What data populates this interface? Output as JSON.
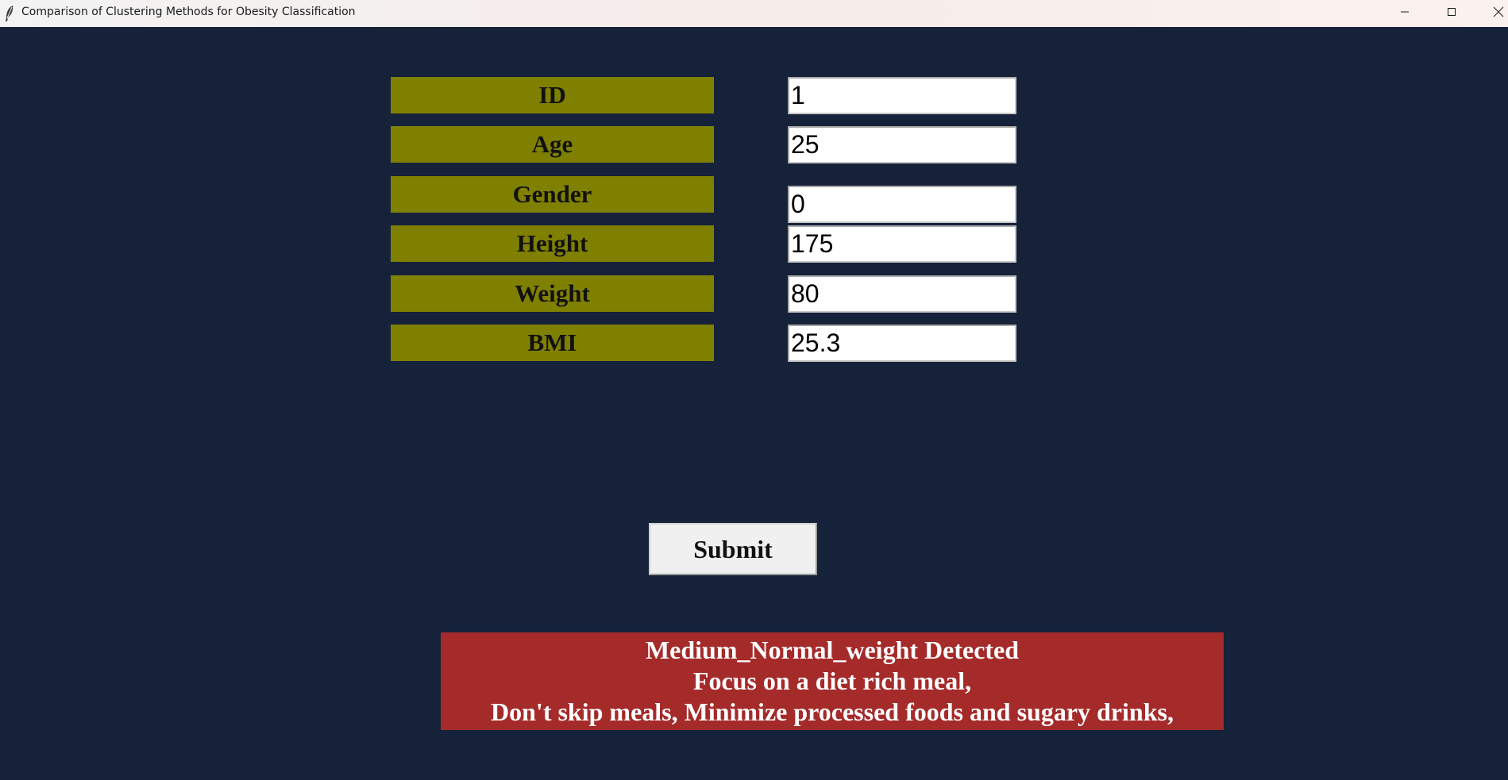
{
  "window": {
    "title": "Comparison of Clustering Methods for Obesity Classification",
    "icon": "feather-icon",
    "controls": [
      "minimize-icon",
      "maximize-icon",
      "close-icon"
    ]
  },
  "form": {
    "fields": [
      {
        "label": "ID",
        "value": "1"
      },
      {
        "label": "Age",
        "value": "25"
      },
      {
        "label": "Gender",
        "value": "0"
      },
      {
        "label": "Height",
        "value": "175"
      },
      {
        "label": "Weight",
        "value": "80"
      },
      {
        "label": "BMI",
        "value": "25.3"
      }
    ],
    "submit_label": "Submit"
  },
  "result": {
    "lines": [
      "Medium_Normal_weight Detected",
      "Focus on a diet rich meal,",
      "Don't skip meals, Minimize processed foods and sugary drinks,"
    ]
  },
  "colors": {
    "background": "#16213a",
    "label_bg": "#808000",
    "result_bg": "#a52a2a",
    "result_text": "#ffffff"
  }
}
